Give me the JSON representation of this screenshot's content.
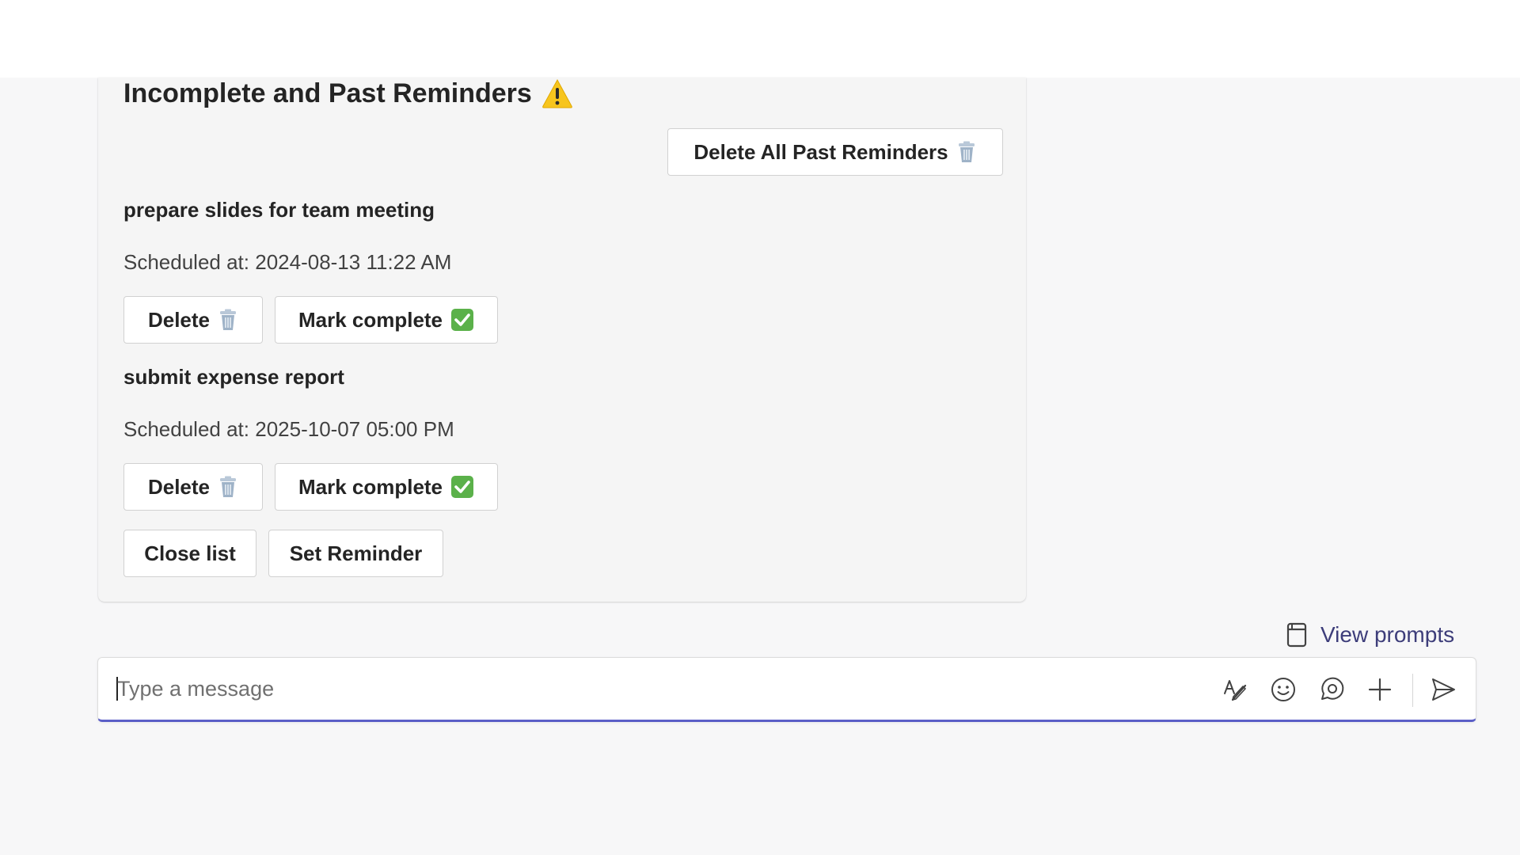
{
  "card": {
    "title": "Incomplete and Past Reminders",
    "delete_all_label": "Delete All Past Reminders"
  },
  "reminders": [
    {
      "title": "prepare slides for team meeting",
      "scheduled": "Scheduled at: 2024-08-13 11:22 AM",
      "delete_label": "Delete",
      "complete_label": "Mark complete"
    },
    {
      "title": "submit expense report",
      "scheduled": "Scheduled at: 2025-10-07 05:00 PM",
      "delete_label": "Delete",
      "complete_label": "Mark complete"
    }
  ],
  "actions": {
    "close_label": "Close list",
    "set_label": "Set Reminder"
  },
  "prompts": {
    "label": "View prompts"
  },
  "composer": {
    "placeholder": "Type a message",
    "value": ""
  },
  "colors": {
    "accent": "#5b5fc7",
    "warning": "#f7c51e",
    "check": "#5bb14a",
    "trash": "#9fb3c8"
  },
  "icons": {
    "title": "warning-icon",
    "delete": "trash-icon",
    "complete": "check-box-icon",
    "prompts": "notebook-icon",
    "tools": [
      "format-icon",
      "emoji-icon",
      "loop-icon",
      "plus-icon",
      "send-icon"
    ]
  }
}
